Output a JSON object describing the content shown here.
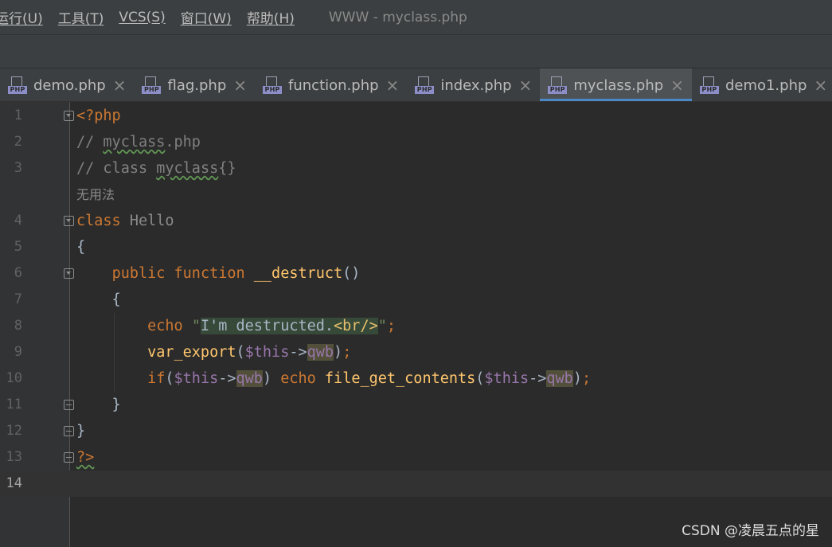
{
  "menu": {
    "items": [
      "运行(U)",
      "工具(T)",
      "VCS(S)",
      "窗口(W)",
      "帮助(H)"
    ],
    "window_title": "WWW - myclass.php"
  },
  "tabs": [
    {
      "label": "demo.php",
      "active": false
    },
    {
      "label": "flag.php",
      "active": false
    },
    {
      "label": "function.php",
      "active": false
    },
    {
      "label": "index.php",
      "active": false
    },
    {
      "label": "myclass.php",
      "active": true
    },
    {
      "label": "demo1.php",
      "active": false
    }
  ],
  "tab_icon_text": "PHP",
  "editor": {
    "line_numbers": [
      "1",
      "2",
      "3",
      "4",
      "5",
      "6",
      "7",
      "8",
      "9",
      "10",
      "11",
      "12",
      "13",
      "14"
    ],
    "inlay_hint": "无用法"
  },
  "colors": {
    "keyword": "#cc7832",
    "comment": "#808080",
    "function": "#ffc66d",
    "variable": "#9876aa",
    "string": "#6a8759",
    "default_text": "#a9b7c6",
    "active_tab_underline": "#4a88c7"
  },
  "watermark": "CSDN @凌晨五点的星"
}
